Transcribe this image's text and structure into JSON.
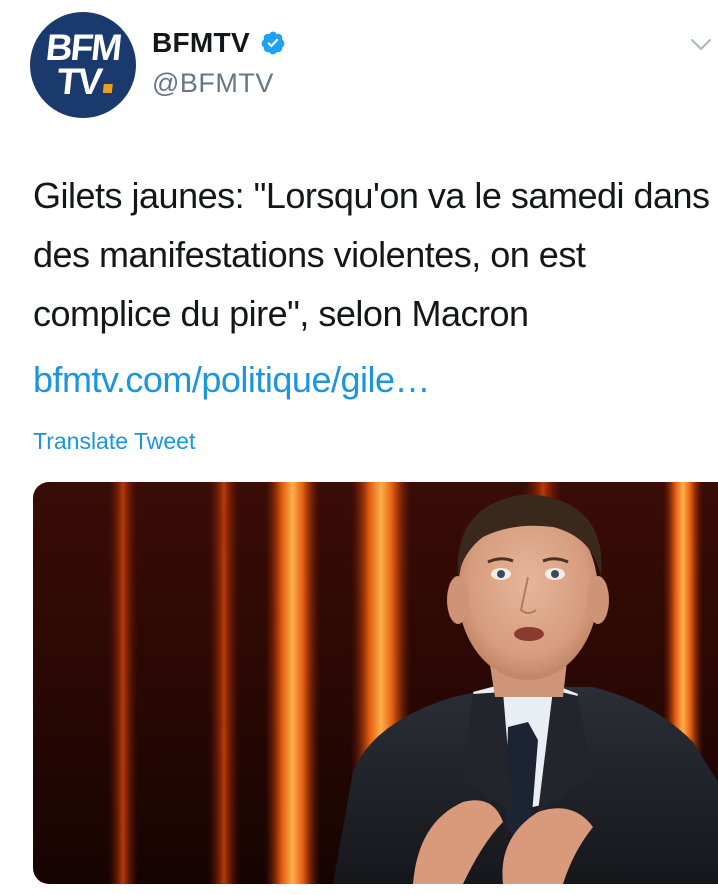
{
  "account": {
    "avatar_line1": "BFM",
    "avatar_line2": "TV",
    "display_name": "BFMTV",
    "handle": "@BFMTV",
    "verified": true
  },
  "tweet": {
    "text": "Gilets jaunes: \"Lorsqu'on va le samedi dans des manifestations violentes, on est complice du pire\", selon Macron",
    "link": "bfmtv.com/politique/gile…",
    "translate_label": "Translate Tweet"
  },
  "icons": {
    "verified": "verified-badge-icon",
    "menu": "chevron-down-icon"
  },
  "colors": {
    "link": "#1b95e0",
    "verified": "#1da1f2",
    "avatar_bg": "#1a3a6e",
    "avatar_accent": "#e6a21c",
    "handle": "#657786"
  }
}
